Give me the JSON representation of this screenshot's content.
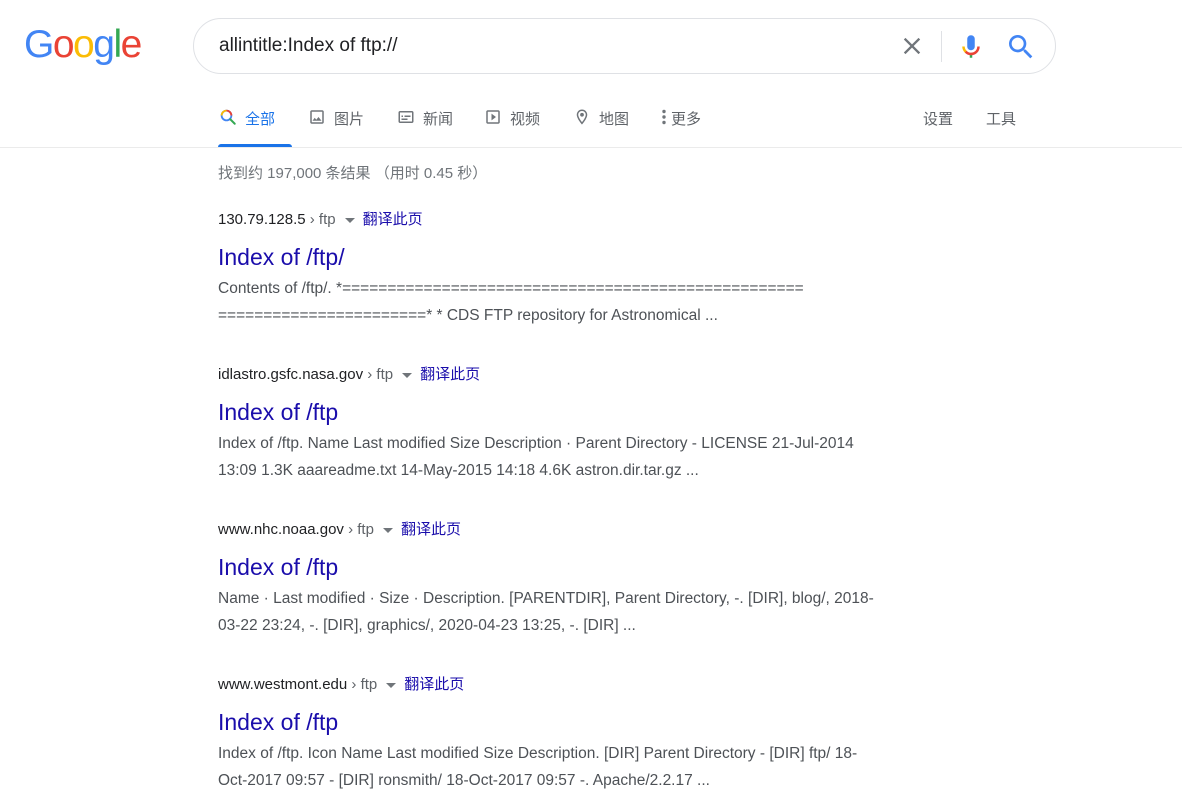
{
  "logo": {
    "letters": [
      "G",
      "o",
      "o",
      "g",
      "l",
      "e"
    ],
    "colors": [
      "#4285f4",
      "#ea4335",
      "#fbbc05",
      "#4285f4",
      "#34a853",
      "#ea4335"
    ],
    "alt": "Google"
  },
  "search": {
    "query": "allintitle:Index of ftp://",
    "clear_icon": "close-icon",
    "mic_icon": "mic-icon",
    "search_icon": "search-icon"
  },
  "tabs": [
    {
      "label": "全部",
      "icon": "search-icon",
      "active": true
    },
    {
      "label": "图片",
      "icon": "image-icon"
    },
    {
      "label": "新闻",
      "icon": "news-icon"
    },
    {
      "label": "视频",
      "icon": "video-icon"
    },
    {
      "label": "地图",
      "icon": "map-pin-icon"
    },
    {
      "label": "更多",
      "icon": "more-vert-icon"
    }
  ],
  "tools": {
    "settings": "设置",
    "tools": "工具"
  },
  "stats": "找到约 197,000 条结果 （用时 0.45 秒）",
  "results": [
    {
      "domain": "130.79.128.5",
      "path": " › ftp",
      "translate": "翻译此页",
      "title": "Index of /ftp/",
      "snippet1": "Contents of /ftp/. *===================================================",
      "snippet2": "=======================* * CDS FTP repository for Astronomical ..."
    },
    {
      "domain": "idlastro.gsfc.nasa.gov",
      "path": " › ftp",
      "translate": "翻译此页",
      "title": "Index of /ftp",
      "snippet1": "Index of /ftp. Name Last modified Size Description · Parent Directory - LICENSE 21-Jul-2014",
      "snippet2": "13:09 1.3K aaareadme.txt 14-May-2015 14:18 4.6K astron.dir.tar.gz ..."
    },
    {
      "domain": "www.nhc.noaa.gov",
      "path": " › ftp",
      "translate": "翻译此页",
      "title": "Index of /ftp",
      "snippet1": "Name · Last modified · Size · Description. [PARENTDIR], Parent Directory, -. [DIR], blog/, 2018-",
      "snippet2": "03-22 23:24, -. [DIR], graphics/, 2020-04-23 13:25, -. [DIR] ..."
    },
    {
      "domain": "www.westmont.edu",
      "path": " › ftp",
      "translate": "翻译此页",
      "title": "Index of /ftp",
      "snippet1": "Index of /ftp. Icon Name Last modified Size Description. [DIR] Parent Directory - [DIR] ftp/ 18-",
      "snippet2": "Oct-2017 09:57 - [DIR] ronsmith/ 18-Oct-2017 09:57 -. Apache/2.2.17 ..."
    }
  ]
}
